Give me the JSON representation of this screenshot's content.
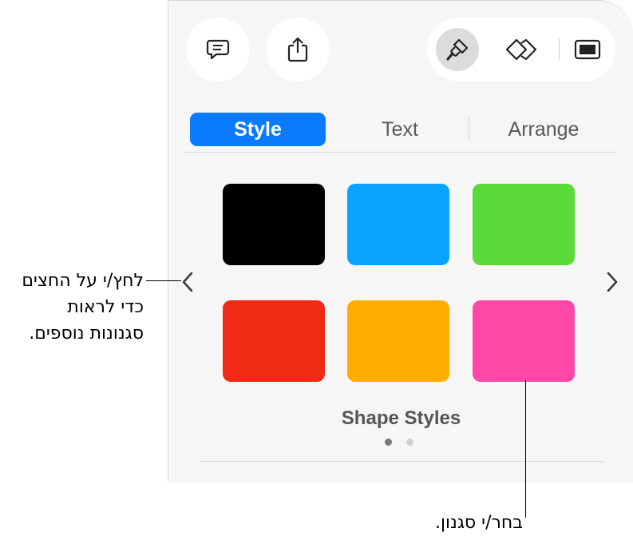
{
  "toolbar": {
    "comment_icon": "speech-bubble-icon",
    "share_icon": "share-icon",
    "format_icon": "paintbrush-icon",
    "animate_icon": "diamond-transition-icon",
    "document_icon": "presenter-window-icon"
  },
  "tabs": [
    {
      "label": "Style",
      "active": true
    },
    {
      "label": "Text",
      "active": false
    },
    {
      "label": "Arrange",
      "active": false
    }
  ],
  "shape_styles": {
    "title": "Shape Styles",
    "swatches": [
      {
        "name": "black",
        "color": "#000000"
      },
      {
        "name": "blue",
        "color": "#0aa2ff"
      },
      {
        "name": "green",
        "color": "#5bdb3a"
      },
      {
        "name": "red",
        "color": "#f02a14"
      },
      {
        "name": "orange",
        "color": "#ffad00"
      },
      {
        "name": "pink",
        "color": "#ff47a8"
      }
    ],
    "page_count": 2,
    "current_page": 1
  },
  "nav": {
    "prev_icon": "chevron-left-icon",
    "next_icon": "chevron-right-icon"
  },
  "callouts": {
    "arrows_line1": "לחץ/י על החצים",
    "arrows_line2": "כדי לראות",
    "arrows_line3": "סגנונות נוספים.",
    "style_label": "בחר/י סגנון."
  },
  "colors": {
    "accent": "#0a7aff",
    "panel_bg": "#f6f6f6"
  }
}
